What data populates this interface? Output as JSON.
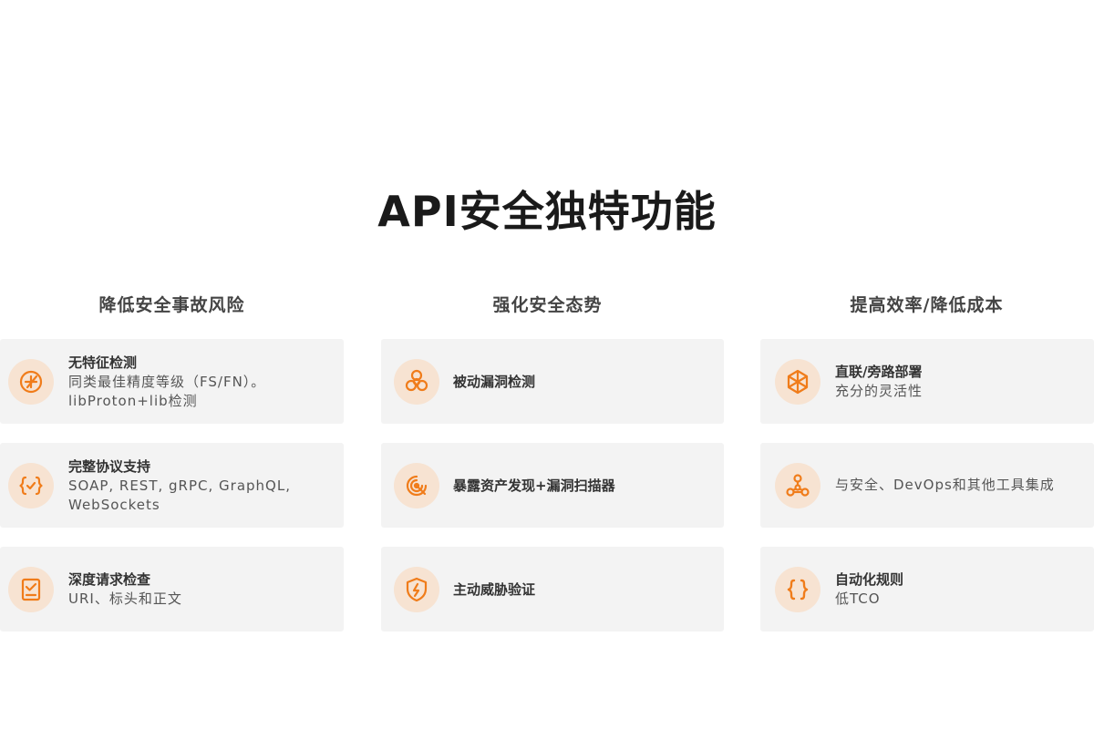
{
  "title": "API安全独特功能",
  "colors": {
    "accent": "#f07c1a",
    "icon_bg": "#f7e3d2",
    "card_bg": "#f3f3f3"
  },
  "columns": [
    {
      "header": "降低安全事故风险",
      "cards": [
        {
          "icon": "crosshair-icon",
          "title": "无特征检测",
          "desc": "同类最佳精度等级（FS/FN）。libProton+lib检测"
        },
        {
          "icon": "curly-brace-check-icon",
          "title": "完整协议支持",
          "desc": "SOAP, REST, gRPC, GraphQL, WebSockets"
        },
        {
          "icon": "checklist-document-icon",
          "title": "深度请求检查",
          "desc": "URI、标头和正文"
        }
      ]
    },
    {
      "header": "强化安全态势",
      "cards": [
        {
          "icon": "biohazard-icon",
          "title": "被动漏洞检测",
          "desc": ""
        },
        {
          "icon": "radar-scan-icon",
          "title": "暴露资产发现+漏洞扫描器",
          "desc": ""
        },
        {
          "icon": "shield-lightning-icon",
          "title": "主动威胁验证",
          "desc": ""
        }
      ]
    },
    {
      "header": "提高效率/降低成本",
      "cards": [
        {
          "icon": "cube-icon",
          "title": "直联/旁路部署",
          "desc": "充分的灵活性"
        },
        {
          "icon": "network-nodes-icon",
          "title": "",
          "desc": "与安全、DevOps和其他工具集成"
        },
        {
          "icon": "curly-braces-icon",
          "title": "自动化规则",
          "desc": "低TCO"
        }
      ]
    }
  ]
}
